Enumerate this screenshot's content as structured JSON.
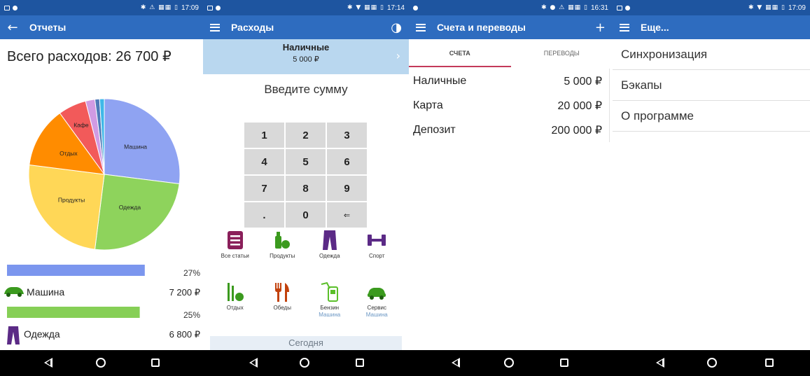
{
  "screens": [
    {
      "status": {
        "time": "17:09",
        "sys": "✱ ⚠ ▦▦ ▯"
      },
      "appbar": {
        "title": "Отчеты",
        "nav_icon": "back-arrow-icon"
      },
      "total_label": "Всего расходов: 26 700 ₽",
      "chart_data": {
        "type": "pie",
        "slices": [
          {
            "label": "Машина",
            "value": 27,
            "color": "#8fa3f2"
          },
          {
            "label": "Одежда",
            "value": 25,
            "color": "#8ed35c"
          },
          {
            "label": "Продукты",
            "value": 25,
            "color": "#ffd757"
          },
          {
            "label": "Отдых",
            "value": 13,
            "color": "#ff8c00"
          },
          {
            "label": "Кафе",
            "value": 6,
            "color": "#f25a5a"
          },
          {
            "label": "",
            "value": 2,
            "color": "#d19be3"
          },
          {
            "label": "",
            "value": 1,
            "color": "#4f7ab8"
          },
          {
            "label": "",
            "value": 1,
            "color": "#3fb8e8"
          }
        ]
      },
      "breakdown": [
        {
          "name": "Машина",
          "amount": "7 200 ₽",
          "percent_label": "27%",
          "fraction": 0.82,
          "color": "#7b96ee",
          "icon": "car-icon"
        },
        {
          "name": "Одежда",
          "amount": "6 800 ₽",
          "percent_label": "25%",
          "fraction": 0.79,
          "color": "#86cf56",
          "icon": "pants-icon"
        }
      ]
    },
    {
      "status": {
        "time": "17:14",
        "sys": "✱ ▼ ▦▦ ▯"
      },
      "appbar": {
        "title": "Расходы",
        "nav_icon": "menu-icon",
        "action_icon": "pie-chart-icon"
      },
      "account": {
        "name": "Наличные",
        "amount": "5 000 ₽"
      },
      "prompt": "Введите сумму",
      "keys": [
        "1",
        "2",
        "3",
        "4",
        "5",
        "6",
        "7",
        "8",
        "9",
        ".",
        "0",
        "⇐"
      ],
      "categories": [
        {
          "label": "Все статьи",
          "sub": "",
          "icon": "all-articles-icon",
          "color": "#8a1f5a"
        },
        {
          "label": "Продукты",
          "sub": "",
          "icon": "groceries-icon",
          "color": "#3b9a1e"
        },
        {
          "label": "Одежда",
          "sub": "",
          "icon": "pants-icon",
          "color": "#5b2a86"
        },
        {
          "label": "Спорт",
          "sub": "",
          "icon": "dumbbell-icon",
          "color": "#5b2a86"
        },
        {
          "label": "Отдых",
          "sub": "",
          "icon": "leisure-icon",
          "color": "#3b9a1e"
        },
        {
          "label": "Обеды",
          "sub": "",
          "icon": "cutlery-icon",
          "color": "#c2410c"
        },
        {
          "label": "Бензин",
          "sub": "Машина",
          "icon": "fuel-icon",
          "color": "#5bbf2a"
        },
        {
          "label": "Сервис",
          "sub": "Машина",
          "icon": "car-service-icon",
          "color": "#3b9a1e"
        }
      ],
      "today_label": "Сегодня"
    },
    {
      "status": {
        "time": "16:31",
        "sys": "✱ ● ⚠ ▦▦ ▯"
      },
      "appbar": {
        "title": "Счета и переводы",
        "nav_icon": "menu-icon",
        "action": "+"
      },
      "tabs": [
        "СЧЕТА",
        "ПЕРЕВОДЫ"
      ],
      "accounts": [
        {
          "name": "Наличные",
          "amount": "5 000 ₽"
        },
        {
          "name": "Карта",
          "amount": "20 000 ₽"
        },
        {
          "name": "Депозит",
          "amount": "200 000 ₽"
        }
      ]
    },
    {
      "status": {
        "time": "17:09",
        "sys": "✱ ▼ ▦▦ ▯"
      },
      "appbar": {
        "title": "Еще...",
        "nav_icon": "menu-icon"
      },
      "items": [
        "Синхронизация",
        "Бэкапы",
        "О программе"
      ]
    }
  ],
  "navbar": {
    "buttons": [
      "back-icon",
      "home-icon",
      "recents-icon"
    ]
  }
}
